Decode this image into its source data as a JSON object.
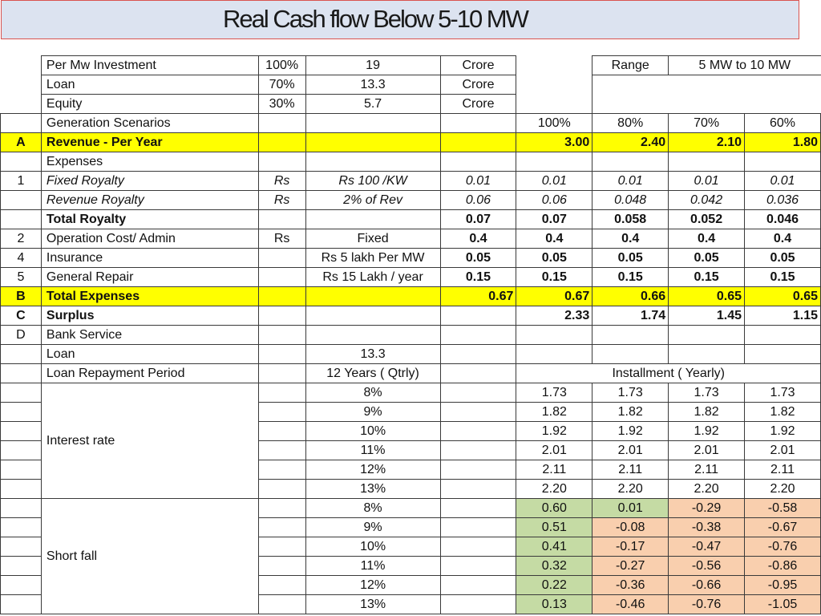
{
  "title": "Real Cash flow Below  5-10  MW",
  "top": {
    "investment": {
      "label": "Per Mw Investment",
      "pct": "100%",
      "value": "19",
      "unit": "Crore"
    },
    "loan": {
      "label": "Loan",
      "pct": "70%",
      "value": "13.3",
      "unit": "Crore"
    },
    "equity": {
      "label": "Equity",
      "pct": "30%",
      "value": "5.7",
      "unit": "Crore"
    },
    "range_label": "Range",
    "range_value": "5 MW to 10 MW"
  },
  "scenarios": {
    "label": "Generation Scenarios",
    "values": [
      "100%",
      "80%",
      "70%",
      "60%"
    ]
  },
  "revenue": {
    "idx": "A",
    "label": "Revenue - Per Year",
    "values": [
      "3.00",
      "2.40",
      "2.10",
      "1.80"
    ]
  },
  "expenses_label": "Expenses",
  "fixed_royalty": {
    "idx": "1",
    "label": "Fixed Royalty",
    "unit": "Rs",
    "basis": "Rs 100 /KW",
    "values": [
      "0.01",
      "0.01",
      "0.01",
      "0.01",
      "0.01"
    ]
  },
  "revenue_royalty": {
    "label": "Revenue Royalty",
    "unit": "Rs",
    "basis": "2% of Rev",
    "values": [
      "0.06",
      "0.06",
      "0.048",
      "0.042",
      "0.036"
    ]
  },
  "total_royalty": {
    "label": "Total Royalty",
    "values": [
      "0.07",
      "0.07",
      "0.058",
      "0.052",
      "0.046"
    ]
  },
  "operation": {
    "idx": "2",
    "label": "Operation Cost/ Admin",
    "unit": "Rs",
    "basis": "Fixed",
    "values": [
      "0.4",
      "0.4",
      "0.4",
      "0.4",
      "0.4"
    ]
  },
  "insurance": {
    "idx": "4",
    "label": "Insurance",
    "basis": "Rs 5 lakh Per MW",
    "values": [
      "0.05",
      "0.05",
      "0.05",
      "0.05",
      "0.05"
    ]
  },
  "repair": {
    "idx": "5",
    "label": "General Repair",
    "basis": "Rs 15 Lakh / year",
    "values": [
      "0.15",
      "0.15",
      "0.15",
      "0.15",
      "0.15"
    ]
  },
  "total_expenses": {
    "idx": "B",
    "label": "Total Expenses",
    "values": [
      "0.67",
      "0.67",
      "0.66",
      "0.65",
      "0.65"
    ]
  },
  "surplus": {
    "idx": "C",
    "label": "Surplus",
    "values": [
      "2.33",
      "1.74",
      "1.45",
      "1.15"
    ]
  },
  "bank_service": {
    "idx": "D",
    "label": "Bank Service"
  },
  "loan_row": {
    "label": "Loan",
    "value": "13.3"
  },
  "repayment": {
    "label": "Loan Repayment Period",
    "period": "12 Years ( Qtrly)",
    "installment_label": "Installment ( Yearly)"
  },
  "interest": {
    "label": "Interest rate",
    "rows": [
      {
        "rate": "8%",
        "values": [
          "1.73",
          "1.73",
          "1.73",
          "1.73"
        ]
      },
      {
        "rate": "9%",
        "values": [
          "1.82",
          "1.82",
          "1.82",
          "1.82"
        ]
      },
      {
        "rate": "10%",
        "values": [
          "1.92",
          "1.92",
          "1.92",
          "1.92"
        ]
      },
      {
        "rate": "11%",
        "values": [
          "2.01",
          "2.01",
          "2.01",
          "2.01"
        ]
      },
      {
        "rate": "12%",
        "values": [
          "2.11",
          "2.11",
          "2.11",
          "2.11"
        ]
      },
      {
        "rate": "13%",
        "values": [
          "2.20",
          "2.20",
          "2.20",
          "2.20"
        ]
      }
    ]
  },
  "shortfall": {
    "label": "Short fall",
    "rows": [
      {
        "rate": "8%",
        "values": [
          "0.60",
          "0.01",
          "-0.29",
          "-0.58"
        ]
      },
      {
        "rate": "9%",
        "values": [
          "0.51",
          "-0.08",
          "-0.38",
          "-0.67"
        ]
      },
      {
        "rate": "10%",
        "values": [
          "0.41",
          "-0.17",
          "-0.47",
          "-0.76"
        ]
      },
      {
        "rate": "11%",
        "values": [
          "0.32",
          "-0.27",
          "-0.56",
          "-0.86"
        ]
      },
      {
        "rate": "12%",
        "values": [
          "0.22",
          "-0.36",
          "-0.66",
          "-0.95"
        ]
      },
      {
        "rate": "13%",
        "values": [
          "0.13",
          "-0.46",
          "-0.76",
          "-1.05"
        ]
      }
    ]
  },
  "colors": {
    "highlight": "#ffff00",
    "positive": "#c5dba4",
    "negative": "#f9cfae",
    "title_bg": "#dce3f0"
  }
}
